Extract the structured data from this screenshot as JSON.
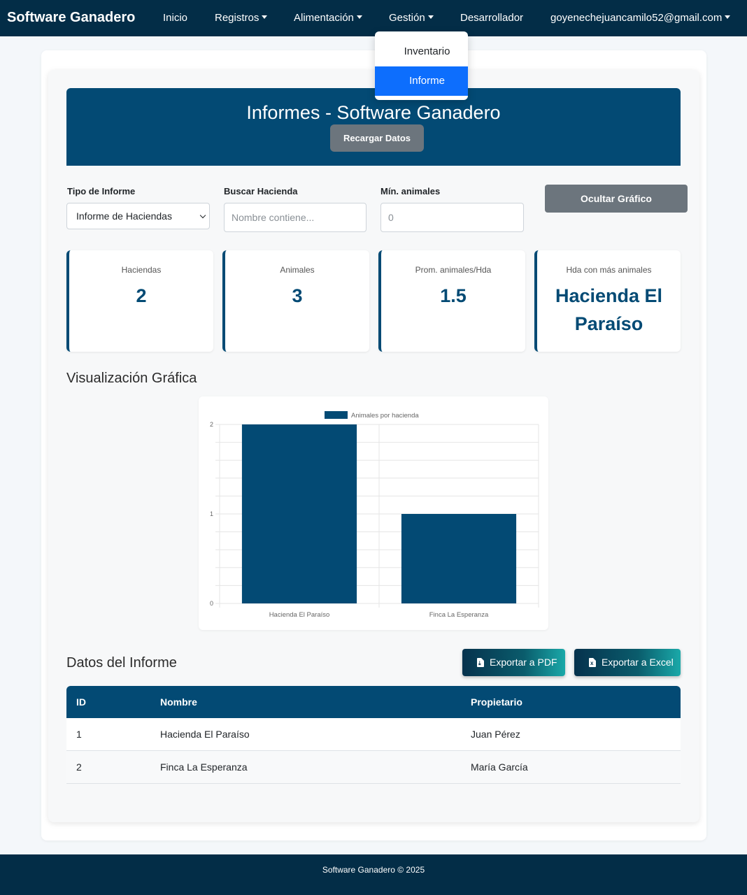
{
  "navbar": {
    "brand": "Software Ganadero",
    "items": [
      {
        "label": "Inicio"
      },
      {
        "label": "Registros"
      },
      {
        "label": "Alimentación"
      },
      {
        "label": "Gestión"
      },
      {
        "label": "Desarrollador"
      },
      {
        "label": "goyenechejuancamilo52@gmail.com"
      }
    ]
  },
  "dropdown": {
    "items": [
      {
        "label": "Inventario",
        "active": false
      },
      {
        "label": "Informe",
        "active": true
      }
    ]
  },
  "header": {
    "title": "Informes - Software Ganadero",
    "reload_label": "Recargar Datos"
  },
  "filters": {
    "type_label": "Tipo de Informe",
    "type_value": "Informe de Haciendas",
    "search_label": "Buscar Hacienda",
    "search_placeholder": "Nombre contiene...",
    "min_label": "Mín. animales",
    "min_placeholder": "0",
    "hide_chart_label": "Ocultar Gráfico"
  },
  "stats": [
    {
      "label": "Haciendas",
      "value": "2"
    },
    {
      "label": "Animales",
      "value": "3"
    },
    {
      "label": "Prom. animales/Hda",
      "value": "1.5"
    },
    {
      "label": "Hda con más animales",
      "value": "Hacienda El Paraíso"
    }
  ],
  "chart_section_title": "Visualización Gráfica",
  "chart_data": {
    "type": "bar",
    "categories": [
      "Hacienda El Paraíso",
      "Finca La Esperanza"
    ],
    "series": [
      {
        "name": "Animales por hacienda",
        "values": [
          2,
          1
        ],
        "color": "#034a74"
      }
    ],
    "ylim": [
      0,
      2
    ],
    "yticks": [
      "0",
      "1",
      "2"
    ],
    "legend": "top",
    "grid": true
  },
  "data_section_title": "Datos del Informe",
  "export": {
    "pdf_label": "Exportar a PDF",
    "excel_label": "Exportar a Excel"
  },
  "table": {
    "headers": [
      "ID",
      "Nombre",
      "Propietario"
    ],
    "rows": [
      [
        "1",
        "Hacienda El Paraíso",
        "Juan Pérez"
      ],
      [
        "2",
        "Finca La Esperanza",
        "María García"
      ]
    ]
  },
  "footer": {
    "text": "Software Ganadero © 2025"
  },
  "colors": {
    "primary": "#034a74",
    "navbar": "#032d47",
    "active": "#0d6efd",
    "muted_button": "#6c757d"
  }
}
